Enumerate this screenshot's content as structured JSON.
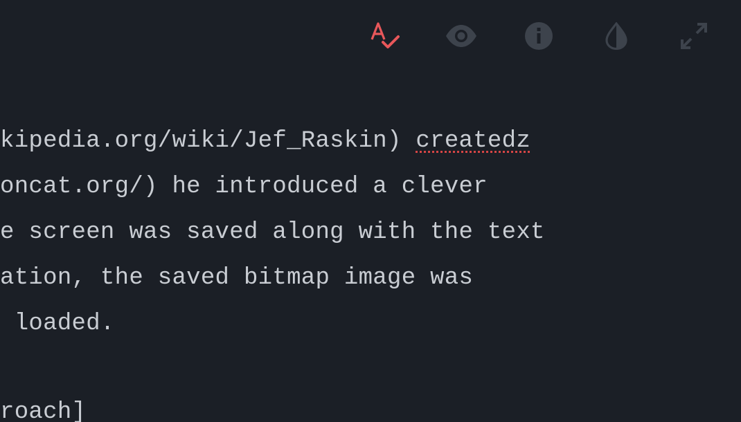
{
  "toolbar": {
    "items": [
      {
        "name": "spellcheck",
        "icon": "spellcheck-icon",
        "active": true,
        "color": "#e8575a"
      },
      {
        "name": "preview",
        "icon": "eye-icon",
        "active": false,
        "color": "#3d434c"
      },
      {
        "name": "info",
        "icon": "info-icon",
        "active": false,
        "color": "#3d434c"
      },
      {
        "name": "contrast",
        "icon": "contrast-icon",
        "active": false,
        "color": "#3d434c"
      },
      {
        "name": "fullscreen",
        "icon": "expand-icon",
        "active": false,
        "color": "#3d434c"
      }
    ]
  },
  "editor": {
    "lines": [
      {
        "before": "kipedia.org/wiki/Jef_Raskin) ",
        "misspelled": "createdz",
        "after": ""
      },
      {
        "text": "oncat.org/) he introduced a clever"
      },
      {
        "text": "e screen was saved along with the text"
      },
      {
        "text": "ation, the saved bitmap image was"
      },
      {
        "text": " loaded."
      },
      {
        "text": "roach]"
      }
    ]
  },
  "colors": {
    "background": "#1b1f26",
    "text": "#c9cdd3",
    "accent": "#e8575a",
    "icon_inactive": "#3d434c",
    "spell_underline": "#d64545"
  }
}
